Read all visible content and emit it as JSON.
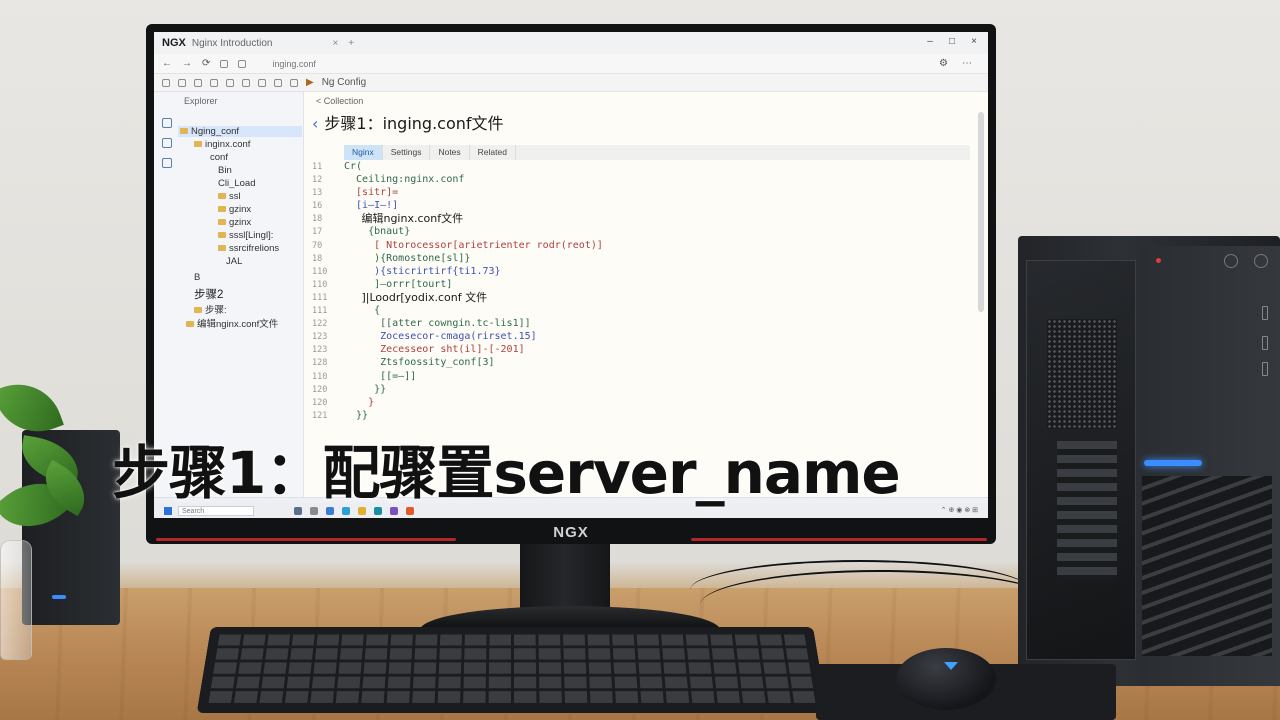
{
  "monitor": {
    "brand": "NGX"
  },
  "window": {
    "logo": "NGX",
    "tab_title": "Nginx Introduction",
    "address": "inging.conf",
    "toolbar_label": "Ng Config"
  },
  "sidebar": {
    "header": "Explorer",
    "items": [
      {
        "label": "Nging_conf",
        "selected": true
      },
      {
        "label": "inginx.conf"
      },
      {
        "label": "conf"
      },
      {
        "label": "Bin"
      },
      {
        "label": "Cli_Load"
      },
      {
        "label": "ssl"
      },
      {
        "label": "gzinx"
      },
      {
        "label": "gzinx"
      },
      {
        "label": "sssl[Lingl]:"
      },
      {
        "label": "ssrcifrelions"
      },
      {
        "label": "JAL"
      },
      {
        "label": "B"
      },
      {
        "label": "步骤2"
      },
      {
        "label": "步骤:"
      },
      {
        "label": "编辑nginx.conf文件"
      }
    ]
  },
  "main": {
    "breadcrumb": "< Collection",
    "title": "步骤1：inging.conf文件",
    "tabs": [
      "Nginx",
      "Settings",
      "Notes",
      "Related"
    ],
    "line_numbers": [
      "11",
      "12",
      "13",
      "16",
      "18",
      "17",
      "70",
      "18",
      "110",
      "110",
      "111",
      "111",
      "122",
      "123",
      "123",
      "128",
      "110",
      "120",
      "120",
      "121"
    ],
    "code_lines": [
      "Cr(",
      "  Ceiling:nginx.conf",
      "  [sitr]=",
      "  [i—I—!]",
      "     编辑nginx.conf文件",
      "    {bnaut}",
      "     [ Ntorocessor[arietrienter rodr(reot)]",
      "     ){Romostone[sl]}",
      "     ){sticrirtirf{ti1.73}",
      "     ]—orrr[tourt]",
      "     ]|Loodr[yodix.conf 文件",
      "     {",
      "      [[atter cowngin.tc-lis1]]",
      "      Zocesecor-cmaga(rirset.15]",
      "      Zecesseor sht(il]-[-201]",
      "      Ztsfoossity_conf[3]",
      "      [[=—]]",
      "     }}",
      "    }",
      "  }}"
    ]
  },
  "taskbar": {
    "search_placeholder": "Search",
    "tray": "⌃ ⊕ ◉ ⊗ ⊞"
  },
  "overlay": {
    "title": "步骤1：配骤置server_name"
  },
  "colors": {
    "accent": "#3a6fd4",
    "desk": "#b88755",
    "tower_led": "#3b8dff"
  }
}
